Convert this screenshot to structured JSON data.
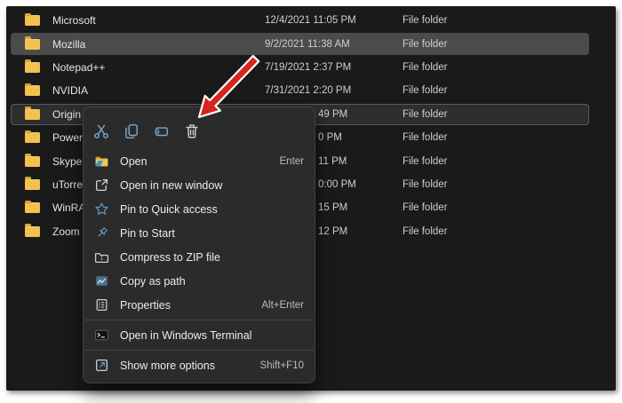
{
  "file_list": {
    "rows": [
      {
        "name": "Microsoft",
        "date": "12/4/2021 11:05 PM",
        "type": "File folder"
      },
      {
        "name": "Mozilla",
        "date": "9/2/2021 11:38 AM",
        "type": "File folder",
        "state": "hover"
      },
      {
        "name": "Notepad++",
        "date": "7/19/2021 2:37 PM",
        "type": "File folder"
      },
      {
        "name": "NVIDIA",
        "date": "7/31/2021 2:20 PM",
        "type": "File folder"
      },
      {
        "name": "Origin",
        "date_partial": "49 PM",
        "type": "File folder",
        "state": "selected"
      },
      {
        "name": "PowerISO",
        "date_partial": "0 PM",
        "type": "File folder"
      },
      {
        "name": "Skype",
        "date_partial": "11 PM",
        "type": "File folder"
      },
      {
        "name": "uTorrent",
        "date_partial": "0:00 PM",
        "type": "File folder"
      },
      {
        "name": "WinRAR",
        "date_partial": "15 PM",
        "type": "File folder"
      },
      {
        "name": "Zoom",
        "date_partial": "12 PM",
        "type": "File folder"
      }
    ]
  },
  "context_menu": {
    "quick_actions": [
      {
        "name": "cut-icon"
      },
      {
        "name": "copy-icon"
      },
      {
        "name": "rename-icon"
      },
      {
        "name": "delete-icon"
      }
    ],
    "items": [
      {
        "label": "Open",
        "shortcut": "Enter",
        "icon": "open-folder-icon"
      },
      {
        "label": "Open in new window",
        "icon": "open-new-window-icon"
      },
      {
        "label": "Pin to Quick access",
        "icon": "star-icon"
      },
      {
        "label": "Pin to Start",
        "icon": "pin-icon"
      },
      {
        "label": "Compress to ZIP file",
        "icon": "zip-folder-icon"
      },
      {
        "label": "Copy as path",
        "icon": "copy-path-icon"
      },
      {
        "label": "Properties",
        "shortcut": "Alt+Enter",
        "icon": "properties-icon"
      },
      {
        "label": "Open in Windows Terminal",
        "icon": "terminal-icon"
      },
      {
        "label": "Show more options",
        "shortcut": "Shift+F10",
        "icon": "show-more-icon"
      }
    ]
  },
  "annotation": {
    "arrow_points_to": "delete-icon",
    "arrow_color": "#d6251d"
  },
  "colors": {
    "canvas_bg": "#1a1a1a",
    "menu_bg": "#2b2b2b",
    "row_hover": "#4b4b4b",
    "row_selected": "#2e2e2e",
    "folder_yellow": "#f2c14e",
    "accent_blue": "#6fa3d2",
    "icon_blue": "#7da7c9"
  }
}
